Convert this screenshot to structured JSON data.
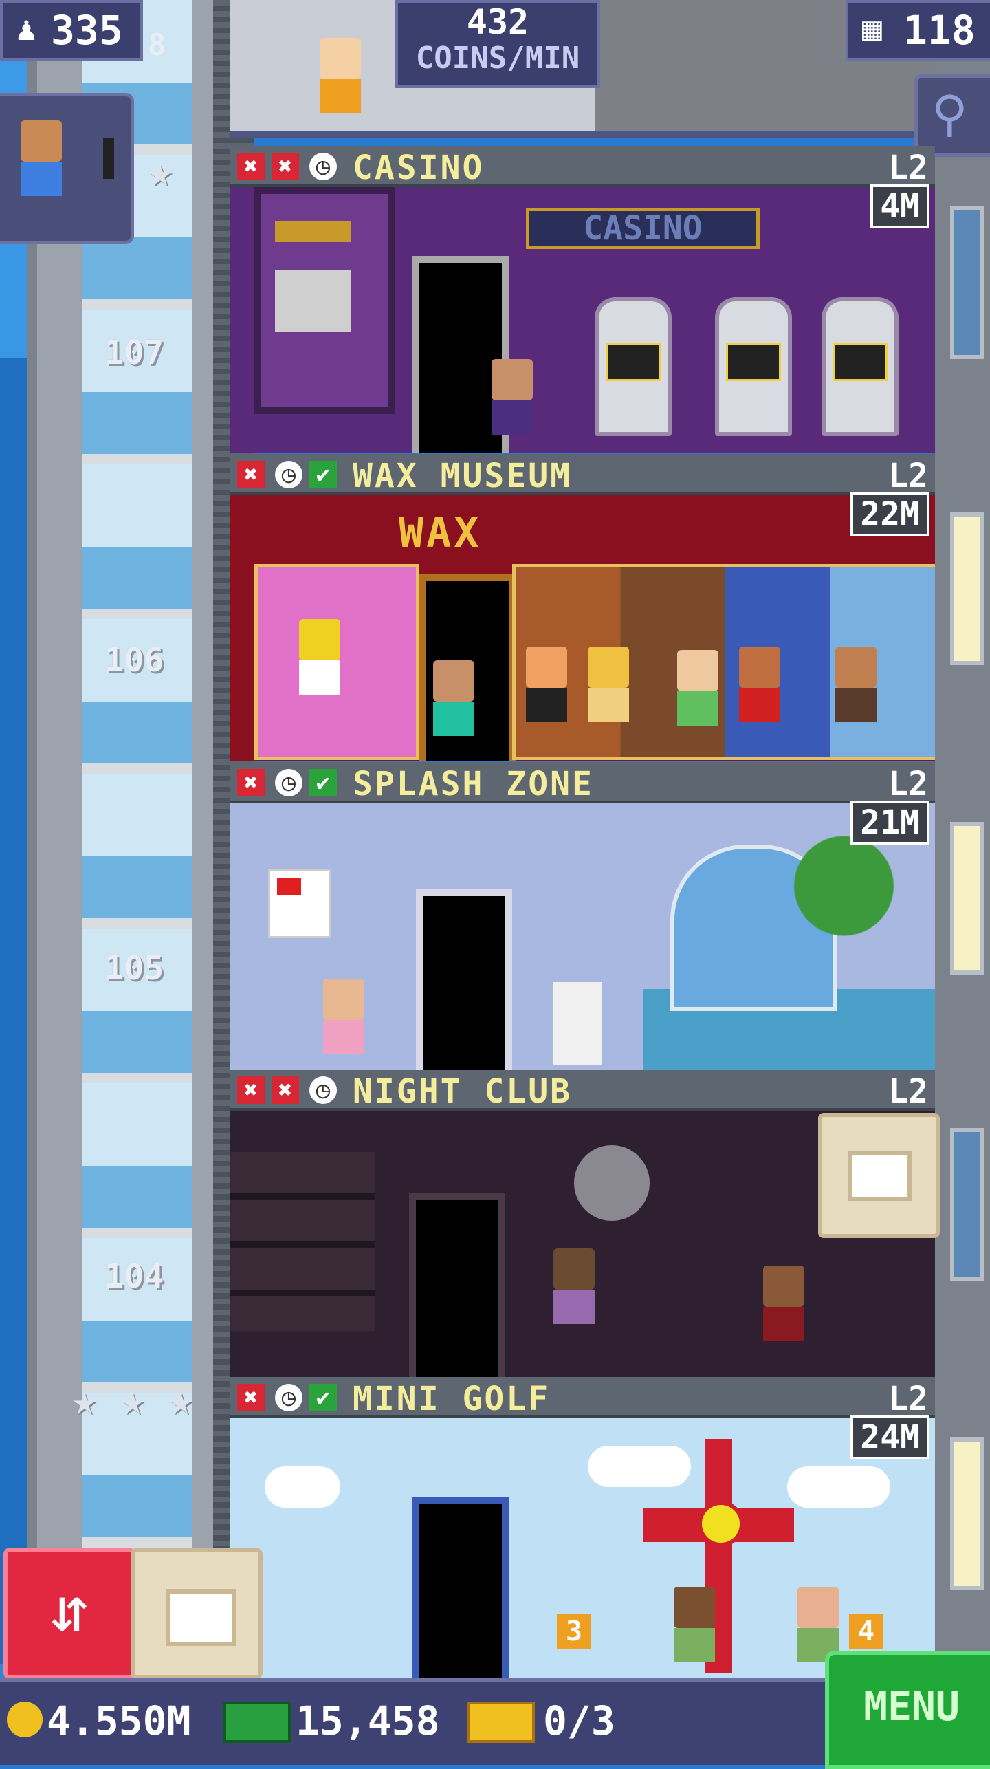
{
  "hud": {
    "population": "335",
    "coins_per_min_value": "432",
    "coins_per_min_label": "COINS/MIN",
    "floors_count": "118",
    "top_floor_partial": "8"
  },
  "elevator_floor_numbers": [
    "107",
    "106",
    "105",
    "104"
  ],
  "floors": [
    {
      "name": "CASINO",
      "level": "L2",
      "earn": "4M",
      "icons": [
        "x",
        "x",
        "clock"
      ]
    },
    {
      "name": "WAX MUSEUM",
      "level": "L2",
      "earn": "22M",
      "sign": "WAX",
      "icons": [
        "x",
        "clock",
        "check"
      ]
    },
    {
      "name": "SPLASH ZONE",
      "level": "L2",
      "earn": "21M",
      "icons": [
        "x",
        "clock",
        "check"
      ]
    },
    {
      "name": "NIGHT CLUB",
      "level": "L2",
      "earn": "",
      "icons": [
        "x",
        "x",
        "clock"
      ]
    },
    {
      "name": "MINI GOLF",
      "level": "L2",
      "earn": "24M",
      "icons": [
        "x",
        "clock",
        "check"
      ],
      "hole_left": "3",
      "hole_right": "4"
    }
  ],
  "casino_sign": "CASINO",
  "bottom_bar": {
    "coins": "4.550M",
    "bux": "15,458",
    "tickets": "0/3",
    "menu_label": "MENU"
  },
  "icons": {
    "population": "person-icon",
    "floors": "building-icon",
    "search": "magnifier-icon",
    "elevator": "up-down-arrows-icon",
    "coin": "coin-icon",
    "bux": "cash-icon",
    "ticket": "ticket-icon"
  },
  "colors": {
    "floor_name": "#f4ee9c",
    "hud_bg": "#3b3f6e",
    "menu": "#1fa838",
    "elevator_button": "#e22840"
  }
}
